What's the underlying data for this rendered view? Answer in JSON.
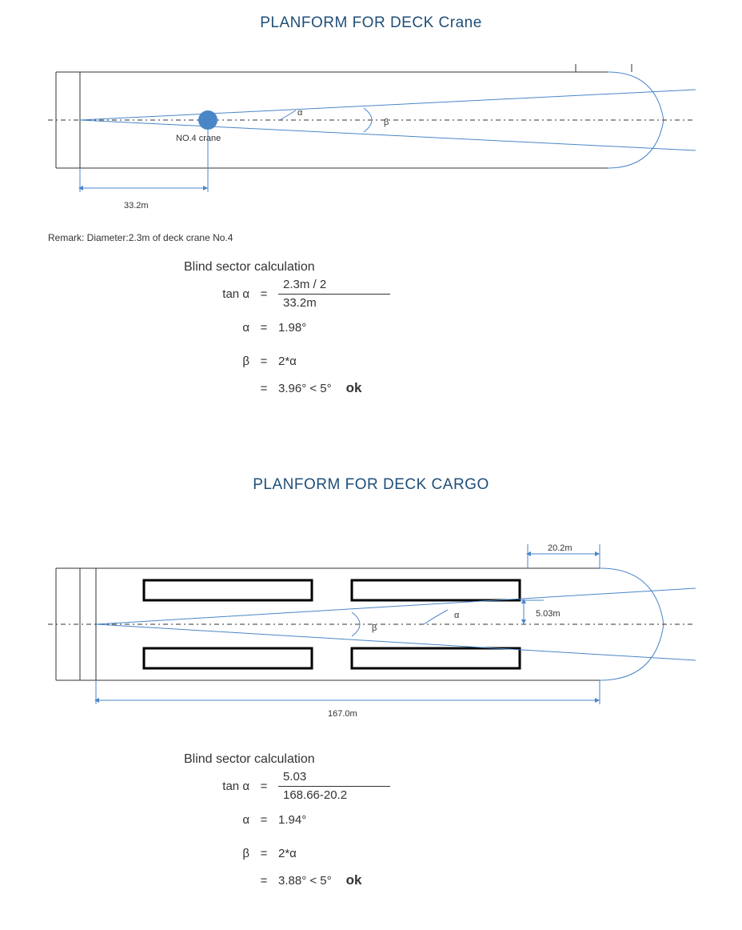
{
  "section1": {
    "title": "PLANFORM FOR DECK Crane",
    "crane_label": "NO.4 crane",
    "dim_distance": "33.2m",
    "alpha_symbol": "α",
    "beta_symbol": "β",
    "remark": "Remark: Diameter:2.3m of deck crane No.4",
    "calc": {
      "title": "Blind sector calculation",
      "tan_lhs": "tan α",
      "frac_num": "2.3m / 2",
      "frac_den": "33.2m",
      "alpha_line_lhs": "α",
      "alpha_line_rhs": "1.98°",
      "beta_lhs": "β",
      "beta_eq1": "2*α",
      "beta_eq2": "3.96° < 5°",
      "ok": "ok"
    }
  },
  "section2": {
    "title": "PLANFORM FOR DECK CARGO",
    "dim_top": "20.2m",
    "dim_side": "5.03m",
    "dim_bottom": "167.0m",
    "alpha_symbol": "α",
    "beta_symbol": "β",
    "calc": {
      "title": "Blind sector calculation",
      "tan_lhs": "tan α",
      "frac_num": "5.03",
      "frac_den": "168.66-20.2",
      "alpha_line_lhs": "α",
      "alpha_line_rhs": "1.94°",
      "beta_lhs": "β",
      "beta_eq1": "2*α",
      "beta_eq2": "3.88° < 5°",
      "ok": "ok"
    }
  },
  "chart_data": [
    {
      "type": "diagram",
      "name": "planform-deck-crane",
      "crane": {
        "diameter_m": 2.3,
        "id": "No.4",
        "distance_from_aft_m": 33.2
      },
      "blind_sector": {
        "alpha_deg": 1.98,
        "beta_deg": 3.96,
        "limit_deg": 5,
        "status": "ok"
      }
    },
    {
      "type": "diagram",
      "name": "planform-deck-cargo",
      "cargo": {
        "half_width_m": 5.03,
        "bow_offset_m": 20.2,
        "length_m": 167.0,
        "reference_length_m": 168.66
      },
      "blind_sector": {
        "alpha_deg": 1.94,
        "beta_deg": 3.88,
        "limit_deg": 5,
        "status": "ok"
      }
    }
  ]
}
